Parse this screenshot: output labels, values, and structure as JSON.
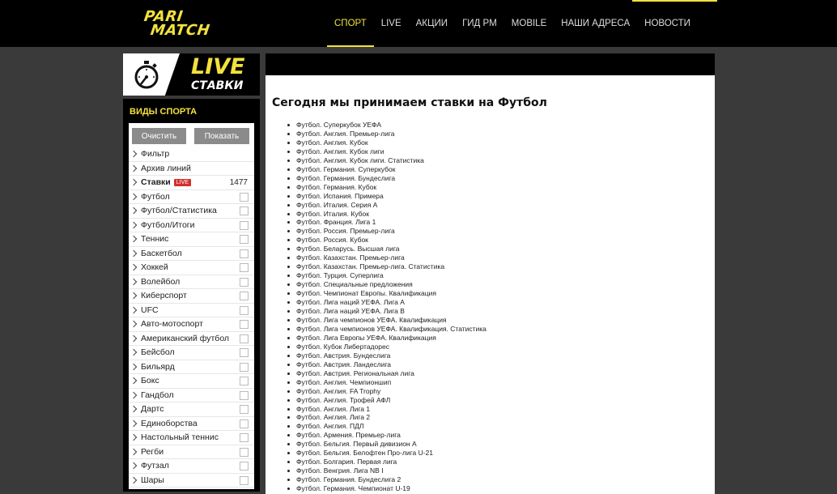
{
  "header": {
    "logo_line1": "PARI",
    "logo_line2": "MATCH",
    "nav": [
      "СПОРТ",
      "LIVE",
      "АКЦИИ",
      "ГИД PM",
      "MOBILE",
      "НАШИ АДРЕСА",
      "НОВОСТИ"
    ],
    "active_nav": "СПОРТ",
    "accent_color": "#f2e23c"
  },
  "live_banner": {
    "title": "LIVE",
    "subtitle": "СТАВКИ",
    "icon": "stopwatch-icon"
  },
  "sidebar": {
    "title": "ВИДЫ СПОРТА",
    "clear_label": "Очистить",
    "show_label": "Показать",
    "plain_items": [
      "Фильтр",
      "Архив линий"
    ],
    "bets_item": {
      "label": "Ставки",
      "badge": "LIVE",
      "count": "1477"
    },
    "sports": [
      "Футбол",
      "Футбол/Статистика",
      "Футбол/Итоги",
      "Теннис",
      "Баскетбол",
      "Хоккей",
      "Волейбол",
      "Киберспорт",
      "UFC",
      "Авто-мотоспорт",
      "Американский футбол",
      "Бейсбол",
      "Бильярд",
      "Бокс",
      "Гандбол",
      "Дартс",
      "Единоборства",
      "Настольный теннис",
      "Регби",
      "Футзал",
      "Шары"
    ]
  },
  "main": {
    "title": "Сегодня мы принимаем ставки на Футбол",
    "leagues": [
      "Футбол. Суперкубок УЕФА",
      "Футбол. Англия. Премьер-лига",
      "Футбол. Англия. Кубок",
      "Футбол. Англия. Кубок лиги",
      "Футбол. Англия. Кубок лиги. Статистика",
      "Футбол. Германия. Суперкубок",
      "Футбол. Германия. Бундеслига",
      "Футбол. Германия. Кубок",
      "Футбол. Испания. Примера",
      "Футбол. Италия. Серия А",
      "Футбол. Италия. Кубок",
      "Футбол. Франция. Лига 1",
      "Футбол. Россия. Премьер-лига",
      "Футбол. Россия. Кубок",
      "Футбол. Беларусь. Высшая лига",
      "Футбол. Казахстан. Премьер-лига",
      "Футбол. Казахстан. Премьер-лига. Статистика",
      "Футбол. Турция. Суперлига",
      "Футбол. Специальные предложения",
      "Футбол. Чемпионат Европы. Квалификация",
      "Футбол. Лига наций УЕФА. Лига А",
      "Футбол. Лига наций УЕФА. Лига В",
      "Футбол. Лига чемпионов УЕФА. Квалификация",
      "Футбол. Лига чемпионов УЕФА. Квалификация. Статистика",
      "Футбол. Лига Европы УЕФА. Квалификация",
      "Футбол. Кубок Либертадорес",
      "Футбол. Австрия. Бундеслига",
      "Футбол. Австрия. Ландеслига",
      "Футбол. Австрия. Региональная лига",
      "Футбол. Англия. Чемпионшип",
      "Футбол. Англия. FA Trophy",
      "Футбол. Англия. Трофей АФЛ",
      "Футбол. Англия. Лига 1",
      "Футбол. Англия. Лига 2",
      "Футбол. Англия. ПДЛ",
      "Футбол. Армения. Премьер-лига",
      "Футбол. Бельгия. Первый дивизион А",
      "Футбол. Бельгия. Белофтен Про-лига U-21",
      "Футбол. Болгария. Первая лига",
      "Футбол. Венгрия. Лига NB I",
      "Футбол. Германия. Бундеслига 2",
      "Футбол. Германия. Чемпионат U-19"
    ]
  }
}
